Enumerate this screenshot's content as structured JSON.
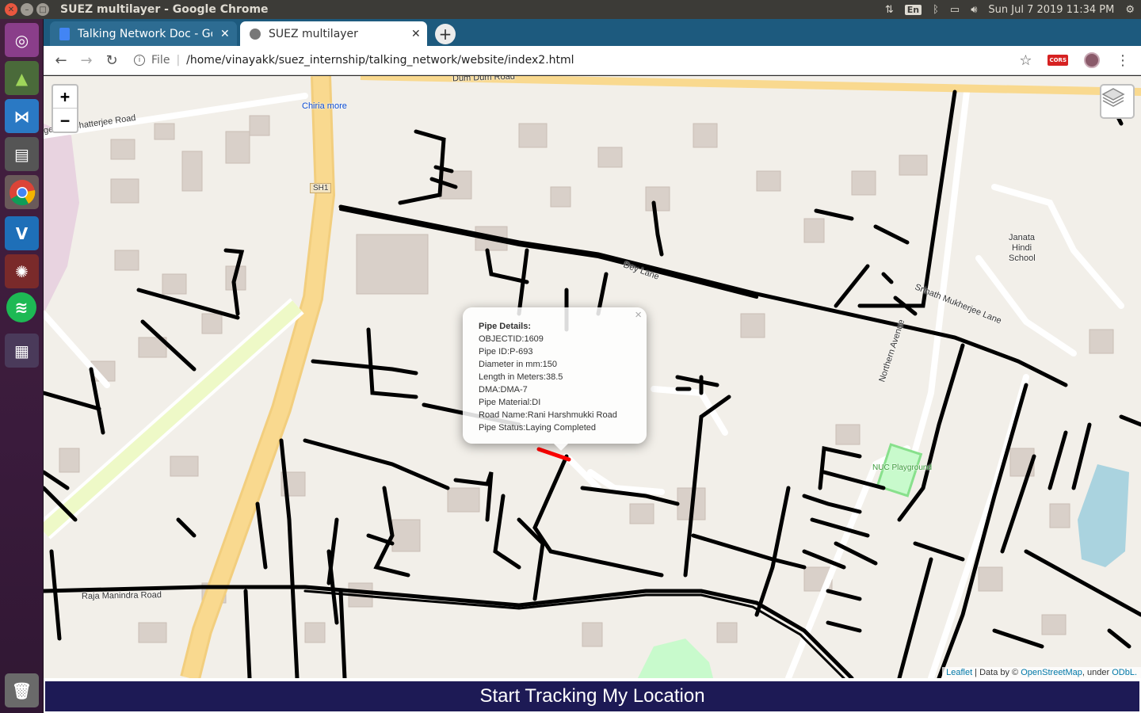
{
  "system": {
    "window_title": "SUEZ multilayer - Google Chrome",
    "language": "En",
    "clock": "Sun Jul 7 2019 11:34 PM"
  },
  "browser": {
    "tabs": [
      {
        "label": "Talking Network Doc - Google Docs",
        "active": false
      },
      {
        "label": "SUEZ multilayer",
        "active": true
      }
    ],
    "scheme_label": "File",
    "url": "/home/vinayakk/suez_internship/talking_network/website/index2.html",
    "cors_label": "CORS"
  },
  "map": {
    "zoom_in": "+",
    "zoom_out": "−",
    "labels": {
      "chiria_more": "Chiria more",
      "sh1": "SH1",
      "nagendra": "agendra Chatterjee Road",
      "dum_dum": "Dum Dum Road",
      "janata_1": "Janata",
      "janata_2": "Hindi",
      "janata_3": "School",
      "srinath": "Srinath Mukherjee Lane",
      "northern": "Northern Avenue",
      "nuc": "NUC Playground",
      "raja": "Raja Manindra Road",
      "dey_lane": "Dey Lane"
    },
    "attribution": {
      "leaflet": "Leaflet",
      "data_by": " | Data by © ",
      "osm": "OpenStreetMap",
      "under": ", under ",
      "odbl": "ODbL."
    }
  },
  "popup": {
    "heading": "Pipe Details:",
    "close": "×",
    "lines": [
      "OBJECTID:1609",
      "Pipe ID:P-693",
      "Diameter in mm:150",
      "Length in Meters:38.5",
      "DMA:DMA-7",
      "Pipe Material:DI",
      "Road Name:Rani Harshmukki Road",
      "Pipe Status:Laying Completed"
    ]
  },
  "track_button": "Start Tracking My Location"
}
